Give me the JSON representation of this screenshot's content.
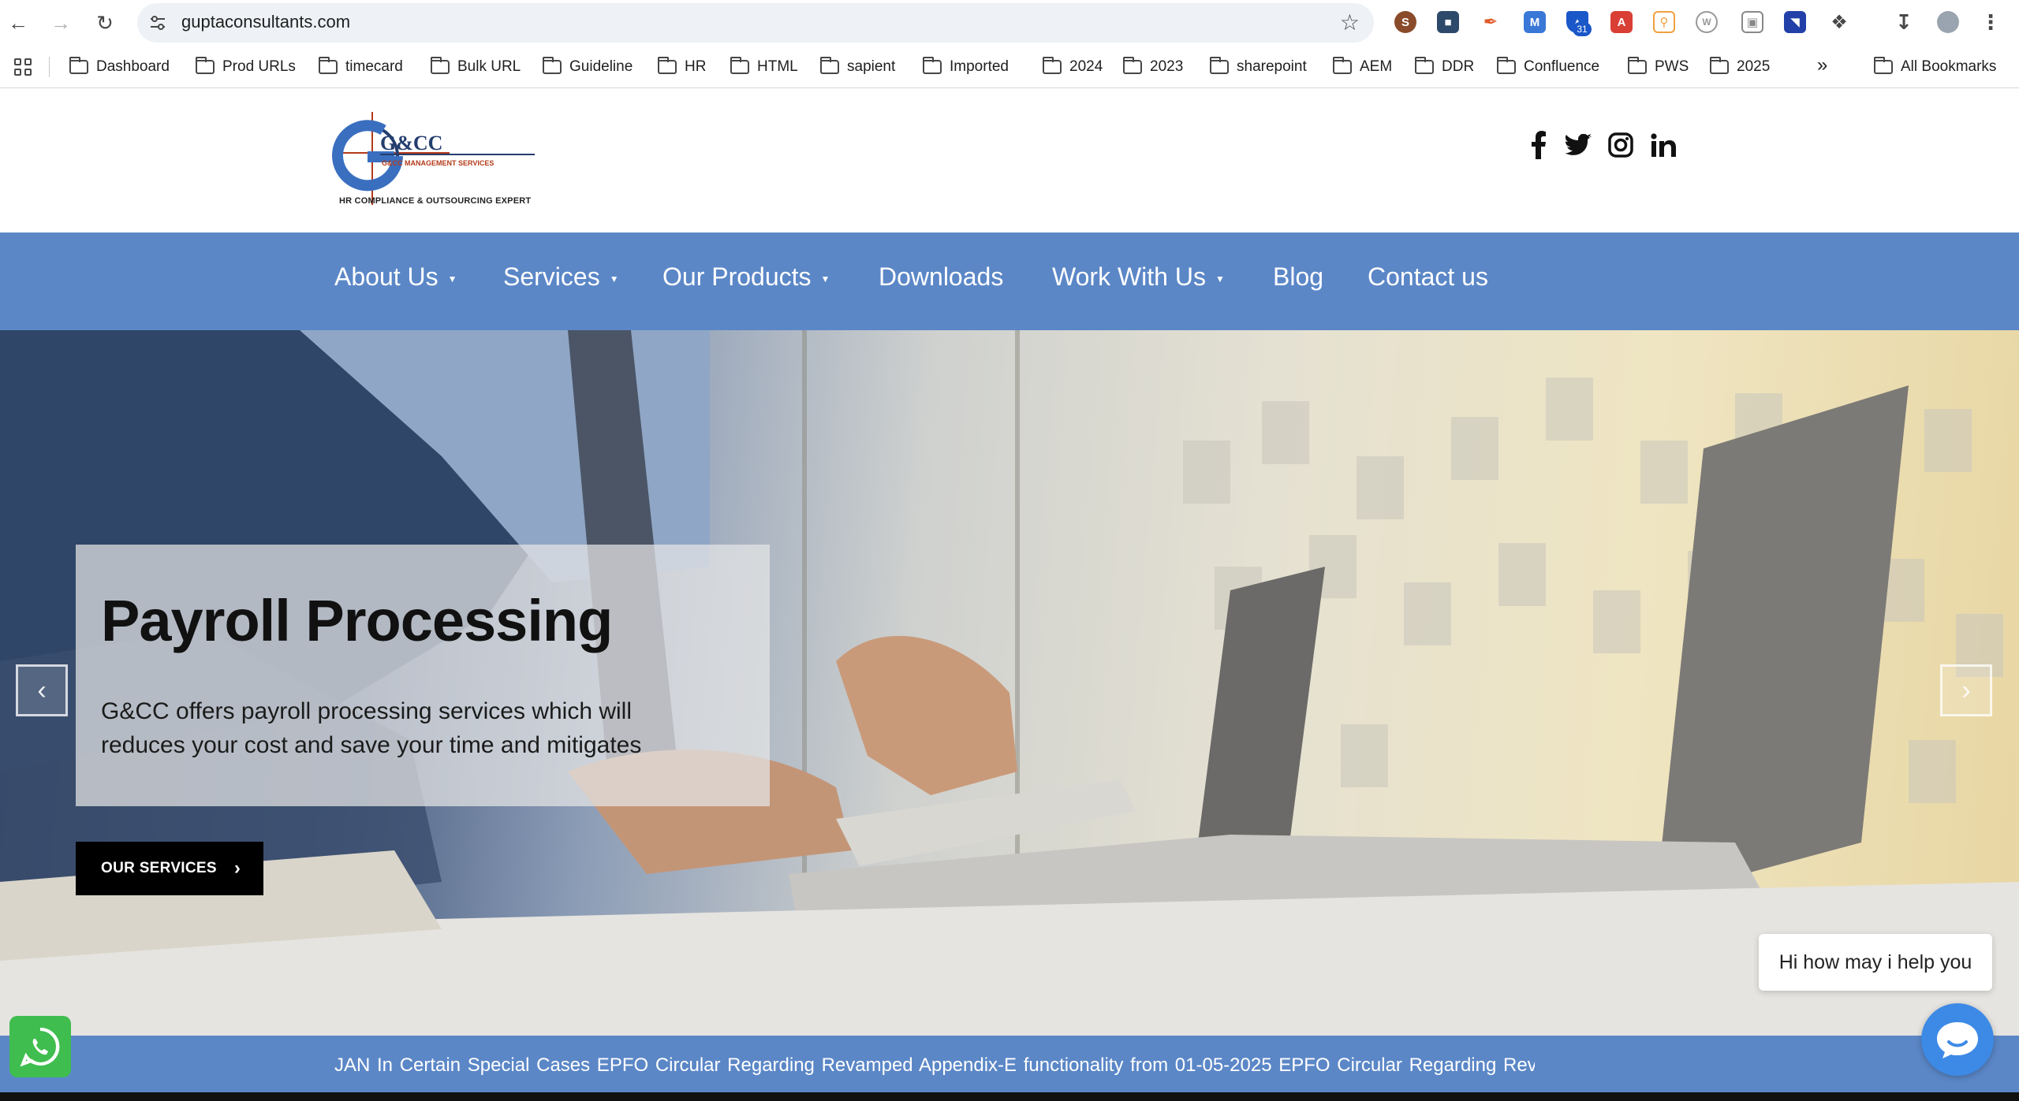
{
  "browser": {
    "url": "guptaconsultants.com",
    "extension_badge": "31",
    "bookmarks": [
      "Dashboard",
      "Prod URLs",
      "timecard",
      "Bulk URL",
      "Guideline",
      "HR",
      "HTML",
      "sapient",
      "Imported",
      "2024",
      "2023",
      "sharepoint",
      "AEM",
      "DDR",
      "Confluence",
      "PWS",
      "2025"
    ],
    "overflow_label": "»",
    "all_bookmarks": "All Bookmarks"
  },
  "site": {
    "logo_text": "G&CC",
    "logo_subtext": "G&CC MANAGEMENT SERVICES",
    "tagline": "HR COMPLIANCE & OUTSOURCING EXPERT",
    "nav": [
      {
        "label": "About Us",
        "caret": "▼"
      },
      {
        "label": "Services",
        "caret": "▼"
      },
      {
        "label": "Our Products",
        "caret": "▼"
      },
      {
        "label": "Downloads"
      },
      {
        "label": "Work With Us",
        "caret": "▼"
      },
      {
        "label": "Blog"
      },
      {
        "label": "Contact us"
      }
    ],
    "social_icons": [
      "facebook-icon",
      "twitter-icon",
      "instagram-icon",
      "linkedin-icon"
    ]
  },
  "hero": {
    "title": "Payroll Processing",
    "text": "G&CC offers payroll processing services which will reduces your cost and save your time and mitigates",
    "cta_label": "OUR SERVICES",
    "cta_chevron": "›",
    "prev_arrow": "‹",
    "next_arrow": "›"
  },
  "chat": {
    "greeting": "Hi how may i help you"
  },
  "ticker": {
    "text": "JAN  In Certain Special Cases     EPFO Circular  Regarding  Revamped Appendix-E functionality from 01-05-2025  EPFO Circular  Regarding  Revamped Appendix-E"
  },
  "colors": {
    "nav_blue": "#5b87c7",
    "cta_black": "#000000",
    "whatsapp_green": "#3fbd4e",
    "chat_blue": "#3d8ae6"
  }
}
